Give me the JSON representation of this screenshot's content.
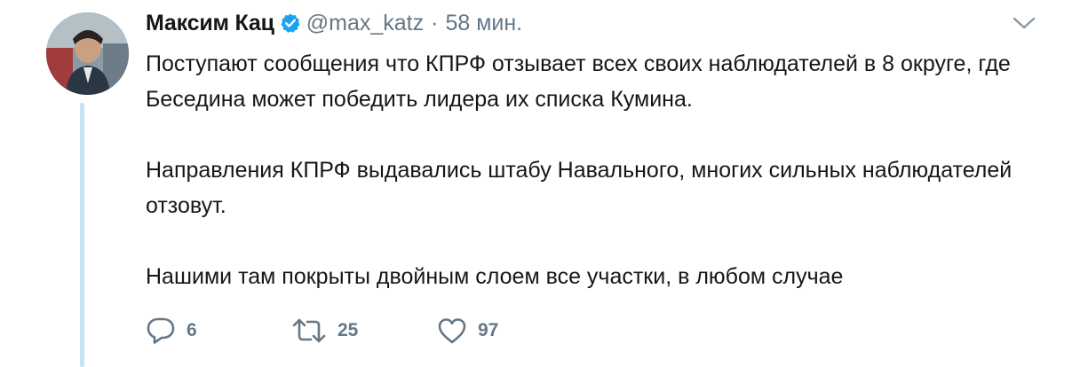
{
  "tweet": {
    "author_name": "Максим Кац",
    "handle": "@max_katz",
    "separator": "·",
    "time": "58 мин.",
    "paragraphs": [
      "Поступают сообщения что КПРФ отзывает всех своих наблюдателей в 8 округе, где Беседина может победить лидера их списка Кумина.",
      "Направления КПРФ выдавались штабу Навального, многих сильных наблюдателей отзовут.",
      "Нашими там покрыты двойным слоем все участки, в любом случае"
    ],
    "replies": "6",
    "retweets": "25",
    "likes": "97"
  },
  "icons": {
    "verified": "verified-badge-icon",
    "caret": "chevron-down-icon",
    "reply": "reply-icon",
    "retweet": "retweet-icon",
    "like": "heart-icon"
  },
  "colors": {
    "accent": "#1da1f2",
    "thread_line": "#c4e3f7",
    "secondary_text": "#657786",
    "primary_text": "#14171a"
  }
}
